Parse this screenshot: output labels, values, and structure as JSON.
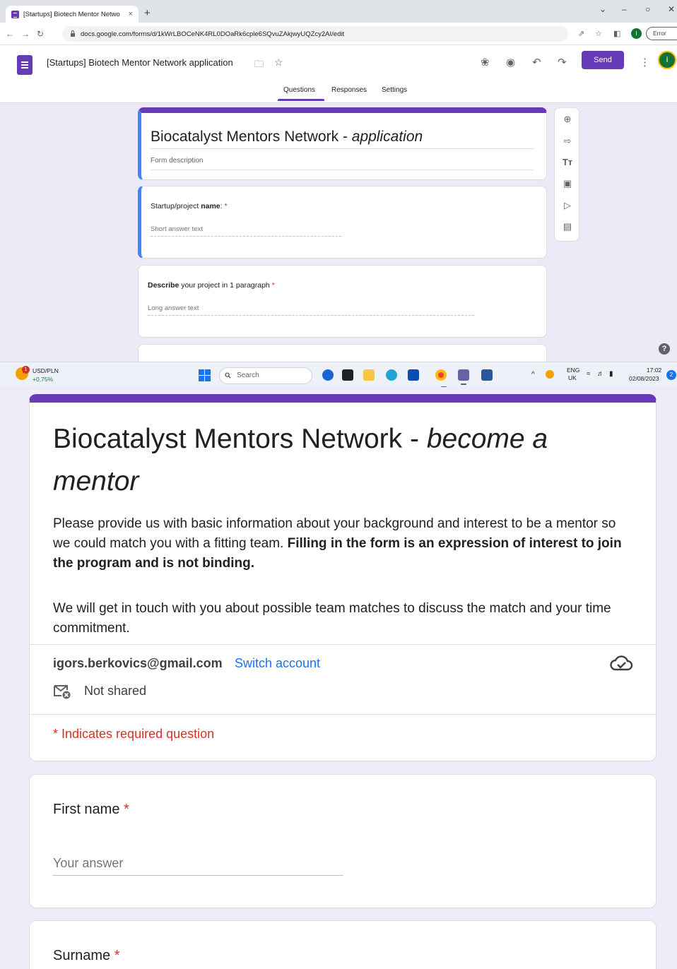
{
  "browser": {
    "tab_title": "[Startups] Biotech Mentor Netwo",
    "tab_close": "×",
    "new_tab": "+",
    "url": "docs.google.com/forms/d/1kWrLBOCeNK4RL0DOaRk6cple6SQvuZAkjwyUQZcy2AI/edit",
    "profile_initial": "I",
    "error_label": "Error"
  },
  "forms_header": {
    "doc_title": "[Startups] Biotech Mentor Network application",
    "send_label": "Send",
    "avatar_initial": "I",
    "tabs": [
      "Questions",
      "Responses",
      "Settings"
    ],
    "active_tab": "Questions"
  },
  "editor": {
    "form_title_main": "Biocatalyst Mentors Network - ",
    "form_title_italic": "application",
    "form_description_placeholder": "Form description",
    "questions": [
      {
        "prefix": "Startup/project ",
        "bold": "name",
        "suffix": ": ",
        "required": "*",
        "hint": "Short answer text"
      },
      {
        "prefix": "",
        "bold": "Describe",
        "suffix": " your project in 1 paragraph ",
        "required": "*",
        "hint": "Long answer text"
      }
    ],
    "help": "?"
  },
  "taskbar": {
    "ticker_name": "USD/PLN",
    "ticker_change": "+0,75%",
    "ticker_badge": "1",
    "search_label": "Search",
    "lang_top": "ENG",
    "lang_bottom": "UK",
    "time": "17:02",
    "date": "02/08/2023",
    "notifications": "2"
  },
  "respondent_form": {
    "title_main": "Biocatalyst Mentors Network - ",
    "title_italic": "become a mentor",
    "description_plain": "Please provide us with basic information about your background and interest to be a mentor so we could match you with a fitting team. ",
    "description_bold": "Filling in the form is an expression of interest to join the program and is not binding.",
    "description_second": "We will get in touch with you about possible team matches to discuss the match and your time commitment.",
    "account_email": "igors.berkovics@gmail.com",
    "switch_account": "Switch account",
    "not_shared": "Not shared",
    "required_note": "* Indicates required question",
    "questions": [
      {
        "title": "First name",
        "required": "*",
        "answer_placeholder": "Your answer"
      },
      {
        "title": "Surname",
        "required": "*"
      }
    ]
  },
  "colors": {
    "accent": "#673ab7",
    "focus_bar": "#4285f4",
    "required": "#d93025",
    "link": "#1a73e8",
    "page_bg": "#f0ebf8"
  }
}
